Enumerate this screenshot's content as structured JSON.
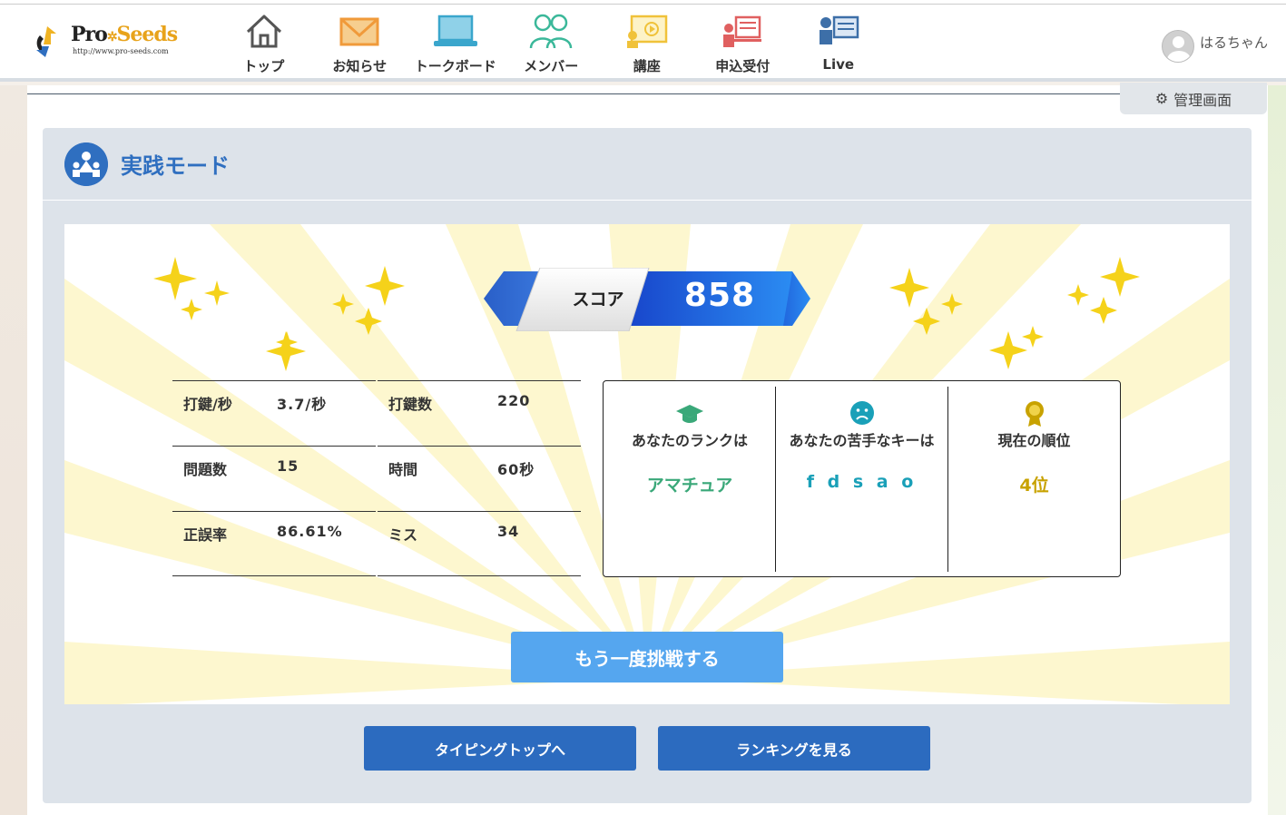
{
  "header": {
    "logo": {
      "brand_pro": "Pro",
      "brand_seeds": "Seeds",
      "url": "http://www.pro-seeds.com"
    },
    "nav": [
      {
        "label": "トップ",
        "icon": "home-icon"
      },
      {
        "label": "お知らせ",
        "icon": "mail-icon"
      },
      {
        "label": "トークボード",
        "icon": "laptop-icon"
      },
      {
        "label": "メンバー",
        "icon": "members-icon"
      },
      {
        "label": "講座",
        "icon": "lecture-icon"
      },
      {
        "label": "申込受付",
        "icon": "application-icon"
      },
      {
        "label": "Live",
        "icon": "live-icon"
      }
    ],
    "user_name": "はるちゃん",
    "admin_label": "管理画面"
  },
  "panel": {
    "title": "実践モード",
    "score_label": "スコア",
    "score_value": "858",
    "stats": {
      "keys_per_sec_label": "打鍵/秒",
      "keys_per_sec": "3.7/秒",
      "keystrokes_label": "打鍵数",
      "keystrokes": "220",
      "questions_label": "問題数",
      "questions": "15",
      "time_label": "時間",
      "time": "60秒",
      "accuracy_label": "正誤率",
      "accuracy": "86.61%",
      "miss_label": "ミス",
      "miss": "34"
    },
    "rank_title": "あなたのランクは",
    "rank_value": "アマチュア",
    "weak_key_title": "あなたの苦手なキーは",
    "weak_key_value": "f d s a o",
    "position_title": "現在の順位",
    "position_value": "4位",
    "retry_label": "もう一度挑戦する",
    "typing_top_label": "タイピングトップへ",
    "ranking_label": "ランキングを見る"
  },
  "colors": {
    "accent_blue": "#2f6fc0",
    "rank_green": "#3aa879",
    "weak_key_teal": "#1aa0b8",
    "position_gold": "#c8a200",
    "retry_button": "#55a6ef",
    "action_button": "#2c6bbf"
  }
}
